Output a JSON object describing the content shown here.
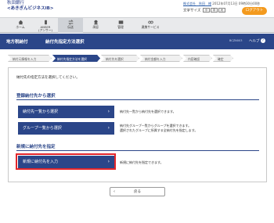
{
  "header": {
    "bank_name": "秋田銀行",
    "service_name": "<あきぎんビジネスIB>",
    "user_line": "株式会社　秋田　様",
    "last_login": "2012年07月13日 09時30分00秒",
    "font_size_label": "文字サイズ",
    "font_sizes": [
      "小",
      "中",
      "大"
    ],
    "logout_label": "ログアウト"
  },
  "nav": {
    "items": [
      {
        "label": "ホーム",
        "icon": "home-icon"
      },
      {
        "label": "ANSER\n(アンサー)",
        "icon": "phone-icon"
      },
      {
        "label": "伝送",
        "icon": "transfer-icon"
      },
      {
        "label": "承認",
        "icon": "approval-icon"
      },
      {
        "label": "管理",
        "icon": "admin-icon"
      },
      {
        "label": "連携サービス",
        "icon": "link-service-icon"
      }
    ]
  },
  "titlebar": {
    "category": "地方税納付",
    "title": "納付先指定方法選択",
    "screen_id": "BCZN003",
    "help_label": "ヘルプ"
  },
  "steps": [
    "納付元情報を入力",
    "納付先指定方法を選択",
    "納付先を選択",
    "納付金額を入力",
    "内容確認",
    "確定"
  ],
  "instruction": "納付先の指定方法を選択してください。",
  "sections": {
    "registered": {
      "heading": "登録納付先から選択",
      "buttons": [
        {
          "label": "納付先一覧から選択",
          "desc": [
            "納付先一覧から納付先を選択できます。"
          ]
        },
        {
          "label": "グループ一覧から選択",
          "desc": [
            "納付先グループ一覧からグループを選択できます。",
            "選択されたグループに所属する全納付先を指定します。"
          ]
        }
      ]
    },
    "new": {
      "heading": "新規に納付先を指定",
      "button": {
        "label": "新規に納付先を入力",
        "desc": [
          "新規に納付先を指定できます。"
        ]
      }
    }
  },
  "back_label": "戻る",
  "colors": {
    "primary": "#2b4689",
    "logout": "#f39a1e",
    "highlight": "#e3262b"
  }
}
